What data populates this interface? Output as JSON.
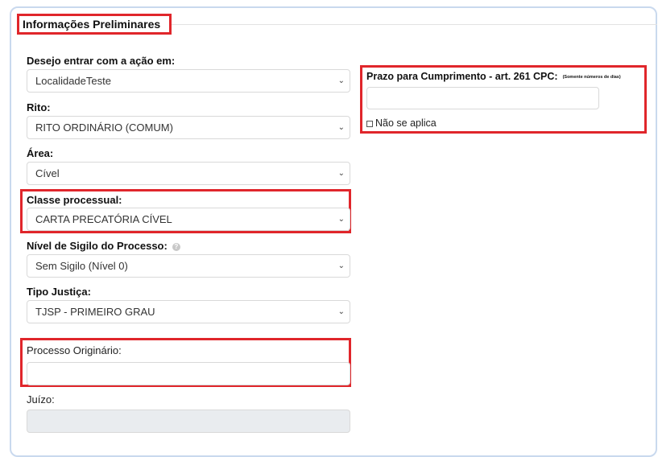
{
  "section": {
    "title": "Informações Preliminares"
  },
  "fields": {
    "localidade": {
      "label": "Desejo entrar com a ação em:",
      "value": "LocalidadeTeste"
    },
    "rito": {
      "label": "Rito:",
      "value": "RITO ORDINÁRIO (COMUM)"
    },
    "area": {
      "label": "Área:",
      "value": "Cível"
    },
    "classe": {
      "label": "Classe processual:",
      "value": "CARTA PRECATÓRIA CÍVEL"
    },
    "sigilo": {
      "label": "Nível de Sigilo do Processo:",
      "value": "Sem Sigilo (Nível 0)",
      "help_icon": "help-icon"
    },
    "tipo_justica": {
      "label": "Tipo Justiça:",
      "value": "TJSP - PRIMEIRO GRAU"
    },
    "processo_originario": {
      "label": "Processo Originário:",
      "value": ""
    },
    "juizo": {
      "label": "Juízo:",
      "value": ""
    },
    "prazo": {
      "label": "Prazo para Cumprimento - art. 261 CPC:",
      "note": "(Somente números de dias)",
      "value": "",
      "checkbox_label": "Não se aplica",
      "checked": false
    }
  },
  "icons": {
    "dropdown": "chevron-down-icon",
    "help": "question-circle-icon"
  },
  "colors": {
    "highlight": "#e0262b",
    "panel_border": "#c9d9ee",
    "disabled_bg": "#e9ecef"
  }
}
